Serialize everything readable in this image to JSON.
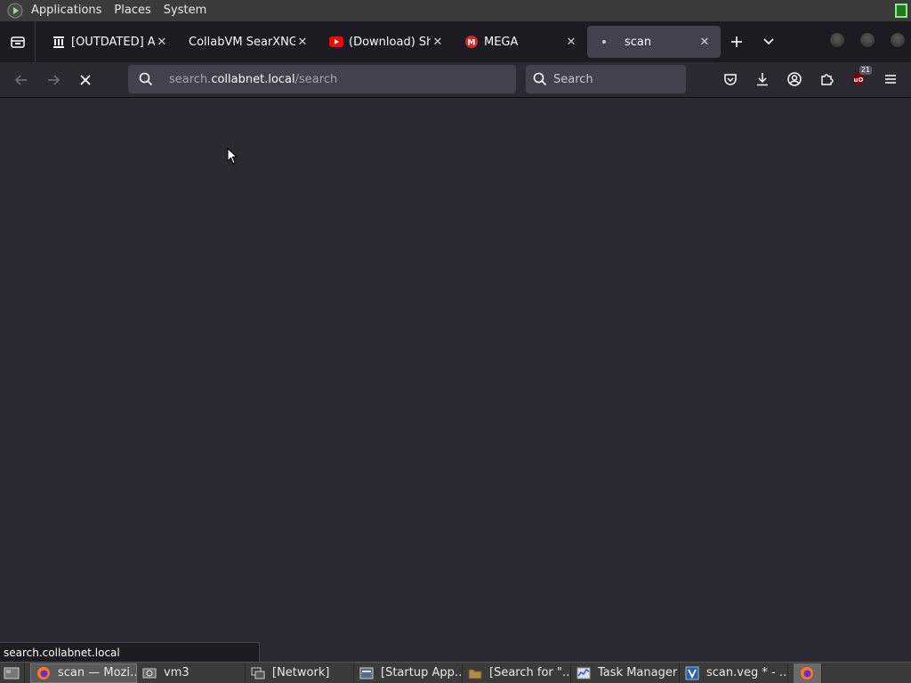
{
  "top_panel": {
    "menus": [
      "Applications",
      "Places",
      "System"
    ],
    "logo_icon": "play-triangle-icon"
  },
  "tabs": [
    {
      "label": "[OUTDATED] Ar",
      "icon": "building-icon",
      "active": false
    },
    {
      "label": "CollabVM SearXNG",
      "icon": "none",
      "active": false
    },
    {
      "label": "(Download) Shu",
      "icon": "youtube-icon",
      "active": false
    },
    {
      "label": "MEGA",
      "icon": "mega-icon",
      "active": false
    },
    {
      "label": "scan",
      "icon": "loading-dot-icon",
      "active": true
    }
  ],
  "urlbar": {
    "prefix": "search.",
    "host": "collabnet.local",
    "path": "/search"
  },
  "searchbar": {
    "placeholder": "Search"
  },
  "toolbar": {
    "ublock_count": "21"
  },
  "status": {
    "link": "search.collabnet.local"
  },
  "taskbar": {
    "items": [
      {
        "label": "scan — Mozi…",
        "icon": "firefox-icon",
        "active": true
      },
      {
        "label": "vm3",
        "icon": "network-icon",
        "active": false
      },
      {
        "label": "[Network]",
        "icon": "window-icon",
        "active": false
      },
      {
        "label": "[Startup App…",
        "icon": "startup-icon",
        "active": false
      },
      {
        "label": "[Search for \"…",
        "icon": "folder-icon",
        "active": false
      },
      {
        "label": "Task Manager",
        "icon": "task-manager-icon",
        "active": false
      },
      {
        "label": "scan.veg * - …",
        "icon": "vegas-icon",
        "active": false
      }
    ]
  },
  "colors": {
    "chrome_bg": "#1c1b22",
    "toolbar_bg": "#2b2a33",
    "field_bg": "#42414d",
    "panel_bg": "#3b3b3b"
  }
}
